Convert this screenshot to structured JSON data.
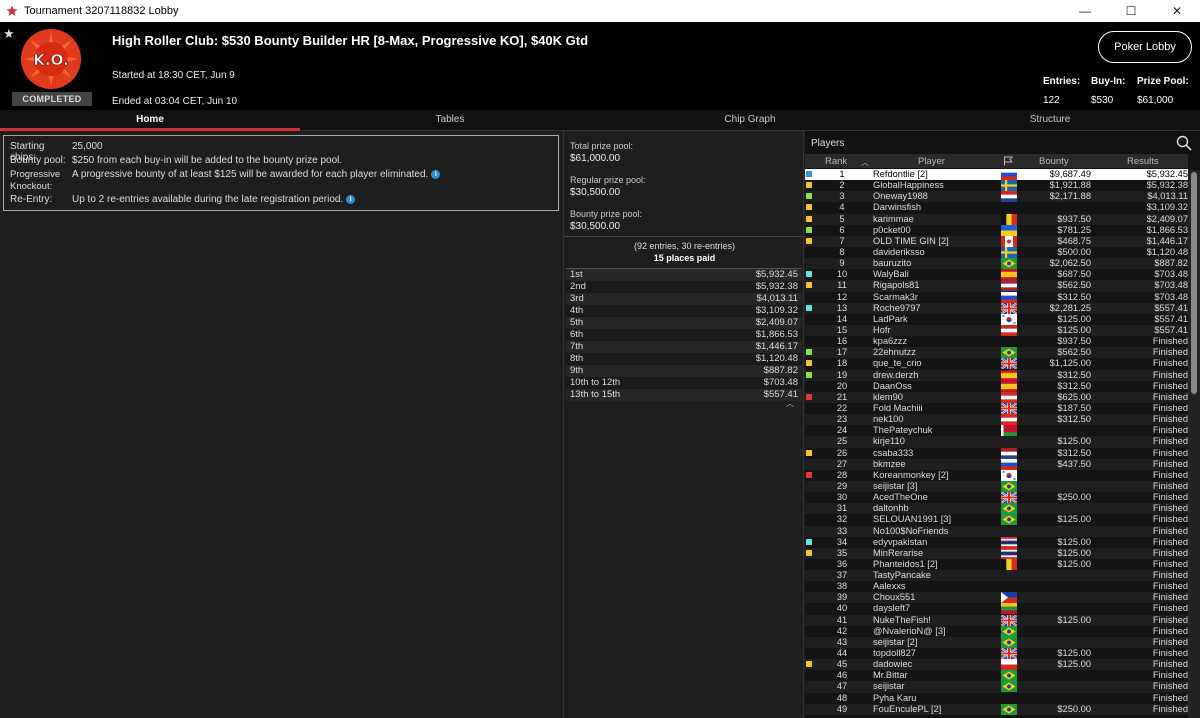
{
  "window": {
    "title": "Tournament 3207118832 Lobby",
    "minimize": "—",
    "maximize": "☐",
    "close": "✕"
  },
  "header": {
    "badge": "COMPLETED",
    "logo_text": "K.O.",
    "title": "High Roller Club: $530 Bounty Builder HR [8-Max, Progressive KO], $40K Gtd",
    "started": "Started at 18:30 CET, Jun 9",
    "ended": "Ended at 03:04 CET, Jun 10",
    "lobby_button": "Poker Lobby",
    "entries_label": "Entries:",
    "entries_value": "122",
    "buyin_label": "Buy-In:",
    "buyin_value": "$530",
    "prizepool_label": "Prize Pool:",
    "prizepool_value": "$61,000"
  },
  "tabs": [
    "Home",
    "Tables",
    "Chip Graph",
    "Structure"
  ],
  "info": {
    "starting_chips_label": "Starting chips:",
    "starting_chips_value": "25,000",
    "bounty_pool_label": "Bounty pool:",
    "bounty_pool_value": "$250 from each buy-in will be added to the bounty prize pool.",
    "progressive_label_1": "Progressive",
    "progressive_label_2": "Knockout:",
    "progressive_value": "A progressive bounty of at least $125 will be awarded for each player eliminated.",
    "reentry_label": "Re-Entry:",
    "reentry_value": "Up to 2 re-entries available during the late registration period."
  },
  "pools": {
    "total_label": "Total prize pool:",
    "total_value": "$61,000.00",
    "regular_label": "Regular prize pool:",
    "regular_value": "$30,500.00",
    "bounty_label": "Bounty prize pool:",
    "bounty_value": "$30,500.00",
    "entries_note": "(92 entries, 30 re-entries)",
    "places_note": "15 places paid"
  },
  "payouts": [
    {
      "place": "1st",
      "amount": "$5,932.45"
    },
    {
      "place": "2nd",
      "amount": "$5,932.38"
    },
    {
      "place": "3rd",
      "amount": "$4,013.11"
    },
    {
      "place": "4th",
      "amount": "$3,109.32"
    },
    {
      "place": "5th",
      "amount": "$2,409.07"
    },
    {
      "place": "6th",
      "amount": "$1,866.53"
    },
    {
      "place": "7th",
      "amount": "$1,446.17"
    },
    {
      "place": "8th",
      "amount": "$1,120.48"
    },
    {
      "place": "9th",
      "amount": "$887.82"
    },
    {
      "place": "10th to 12th",
      "amount": "$703.48"
    },
    {
      "place": "13th to 15th",
      "amount": "$557.41"
    }
  ],
  "players_panel": {
    "title": "Players",
    "col_rank": "Rank",
    "col_player": "Player",
    "col_bounty": "Bounty",
    "col_results": "Results"
  },
  "players": [
    {
      "rank": "1",
      "name": "Refdontlie [2]",
      "bounty": "$9,687.49",
      "result": "$5,932.45",
      "flag": "ru",
      "mark": "#3a8fd8"
    },
    {
      "rank": "2",
      "name": "GlobalHappiness",
      "bounty": "$1,921.88",
      "result": "$5,932.38",
      "flag": "se",
      "mark": "#f2c230"
    },
    {
      "rank": "3",
      "name": "Oneway1988",
      "bounty": "$2,171.88",
      "result": "$4,013.11",
      "flag": "py",
      "mark": "#8ee04a"
    },
    {
      "rank": "4",
      "name": "Darwinsfish",
      "bounty": "",
      "result": "$3,109.32",
      "flag": "none",
      "mark": "#f2c230"
    },
    {
      "rank": "5",
      "name": "karimmae",
      "bounty": "$937.50",
      "result": "$2,409.07",
      "flag": "be",
      "mark": "#f2c230"
    },
    {
      "rank": "6",
      "name": "p0cket00",
      "bounty": "$781.25",
      "result": "$1,866.53",
      "flag": "ua",
      "mark": "#8ee04a"
    },
    {
      "rank": "7",
      "name": "OLD TIME GIN [2]",
      "bounty": "$468.75",
      "result": "$1,446.17",
      "flag": "ca",
      "mark": "#f2c230"
    },
    {
      "rank": "8",
      "name": "davideriksso",
      "bounty": "$500.00",
      "result": "$1,120.48",
      "flag": "se",
      "mark": ""
    },
    {
      "rank": "9",
      "name": "bauruzito",
      "bounty": "$2,062.50",
      "result": "$887.82",
      "flag": "br",
      "mark": ""
    },
    {
      "rank": "10",
      "name": "WalyBali",
      "bounty": "$687.50",
      "result": "$703.48",
      "flag": "es",
      "mark": "#5ee8d8"
    },
    {
      "rank": "11",
      "name": "Rigapols81",
      "bounty": "$562.50",
      "result": "$703.48",
      "flag": "lv",
      "mark": "#f2c230"
    },
    {
      "rank": "12",
      "name": "Scarmak3r",
      "bounty": "$312.50",
      "result": "$703.48",
      "flag": "ru",
      "mark": ""
    },
    {
      "rank": "13",
      "name": "Roche9797",
      "bounty": "$2,281.25",
      "result": "$557.41",
      "flag": "gb",
      "mark": "#5ee8d8"
    },
    {
      "rank": "14",
      "name": "LadPark",
      "bounty": "$125.00",
      "result": "$557.41",
      "flag": "kr",
      "mark": ""
    },
    {
      "rank": "15",
      "name": "Hofr",
      "bounty": "$125.00",
      "result": "$557.41",
      "flag": "at",
      "mark": ""
    },
    {
      "rank": "16",
      "name": "kpa6zzz",
      "bounty": "$937.50",
      "result": "Finished",
      "flag": "none",
      "mark": ""
    },
    {
      "rank": "17",
      "name": "22ehnutzz",
      "bounty": "$562.50",
      "result": "Finished",
      "flag": "br",
      "mark": "#8ee04a"
    },
    {
      "rank": "18",
      "name": "que_te_crio",
      "bounty": "$1,125.00",
      "result": "Finished",
      "flag": "gb",
      "mark": "#f2c230"
    },
    {
      "rank": "19",
      "name": "drew.derzh",
      "bounty": "$312.50",
      "result": "Finished",
      "flag": "es",
      "mark": "#8ee04a"
    },
    {
      "rank": "20",
      "name": "DaanOss",
      "bounty": "$312.50",
      "result": "Finished",
      "flag": "es",
      "mark": ""
    },
    {
      "rank": "21",
      "name": "klem90",
      "bounty": "$625.00",
      "result": "Finished",
      "flag": "at",
      "mark": "#e03a3a"
    },
    {
      "rank": "22",
      "name": "Fold Machiii",
      "bounty": "$187.50",
      "result": "Finished",
      "flag": "gb",
      "mark": ""
    },
    {
      "rank": "23",
      "name": "nek100",
      "bounty": "$312.50",
      "result": "Finished",
      "flag": "at",
      "mark": ""
    },
    {
      "rank": "24",
      "name": "ThePateychuk",
      "bounty": "",
      "result": "Finished",
      "flag": "by",
      "mark": ""
    },
    {
      "rank": "25",
      "name": "kirje110",
      "bounty": "$125.00",
      "result": "Finished",
      "flag": "none",
      "mark": ""
    },
    {
      "rank": "26",
      "name": "csaba333",
      "bounty": "$312.50",
      "result": "Finished",
      "flag": "nl",
      "mark": "#f2c230"
    },
    {
      "rank": "27",
      "name": "bkmzee",
      "bounty": "$437.50",
      "result": "Finished",
      "flag": "ru",
      "mark": ""
    },
    {
      "rank": "28",
      "name": "Koreanmonkey [2]",
      "bounty": "",
      "result": "Finished",
      "flag": "kr",
      "mark": "#e03a3a"
    },
    {
      "rank": "29",
      "name": "seijistar [3]",
      "bounty": "",
      "result": "Finished",
      "flag": "br",
      "mark": ""
    },
    {
      "rank": "30",
      "name": "AcedTheOne",
      "bounty": "$250.00",
      "result": "Finished",
      "flag": "gb",
      "mark": ""
    },
    {
      "rank": "31",
      "name": "daltonhb",
      "bounty": "",
      "result": "Finished",
      "flag": "br",
      "mark": ""
    },
    {
      "rank": "32",
      "name": "SELOUAN1991 [3]",
      "bounty": "$125.00",
      "result": "Finished",
      "flag": "br",
      "mark": ""
    },
    {
      "rank": "33",
      "name": "No100$NoFriends",
      "bounty": "",
      "result": "Finished",
      "flag": "none",
      "mark": ""
    },
    {
      "rank": "34",
      "name": "edyvpakistan",
      "bounty": "$125.00",
      "result": "Finished",
      "flag": "th",
      "mark": "#5ee8d8"
    },
    {
      "rank": "35",
      "name": "MinRerarise",
      "bounty": "$125.00",
      "result": "Finished",
      "flag": "th",
      "mark": "#f2c230"
    },
    {
      "rank": "36",
      "name": "Phanteidos1 [2]",
      "bounty": "$125.00",
      "result": "Finished",
      "flag": "be",
      "mark": ""
    },
    {
      "rank": "37",
      "name": "TastyPancake",
      "bounty": "",
      "result": "Finished",
      "flag": "none",
      "mark": ""
    },
    {
      "rank": "38",
      "name": "Aalexxs",
      "bounty": "",
      "result": "Finished",
      "flag": "none",
      "mark": ""
    },
    {
      "rank": "39",
      "name": "Choux551",
      "bounty": "",
      "result": "Finished",
      "flag": "ph",
      "mark": ""
    },
    {
      "rank": "40",
      "name": "daysleft7",
      "bounty": "",
      "result": "Finished",
      "flag": "lt",
      "mark": ""
    },
    {
      "rank": "41",
      "name": "NukeTheFish!",
      "bounty": "$125.00",
      "result": "Finished",
      "flag": "gb",
      "mark": ""
    },
    {
      "rank": "42",
      "name": "@NvalerioN@ [3]",
      "bounty": "",
      "result": "Finished",
      "flag": "br",
      "mark": ""
    },
    {
      "rank": "43",
      "name": "seijistar [2]",
      "bounty": "",
      "result": "Finished",
      "flag": "br",
      "mark": ""
    },
    {
      "rank": "44",
      "name": "topdoll827",
      "bounty": "$125.00",
      "result": "Finished",
      "flag": "gb",
      "mark": ""
    },
    {
      "rank": "45",
      "name": "dadowiec",
      "bounty": "$125.00",
      "result": "Finished",
      "flag": "pl",
      "mark": "#f2c230"
    },
    {
      "rank": "46",
      "name": "Mr.Bittar",
      "bounty": "",
      "result": "Finished",
      "flag": "br",
      "mark": ""
    },
    {
      "rank": "47",
      "name": "seijistar",
      "bounty": "",
      "result": "Finished",
      "flag": "br",
      "mark": ""
    },
    {
      "rank": "48",
      "name": "Pyha Karu",
      "bounty": "",
      "result": "Finished",
      "flag": "none",
      "mark": ""
    },
    {
      "rank": "49",
      "name": "FouEnculePL [2]",
      "bounty": "$250.00",
      "result": "Finished",
      "flag": "br",
      "mark": ""
    }
  ]
}
